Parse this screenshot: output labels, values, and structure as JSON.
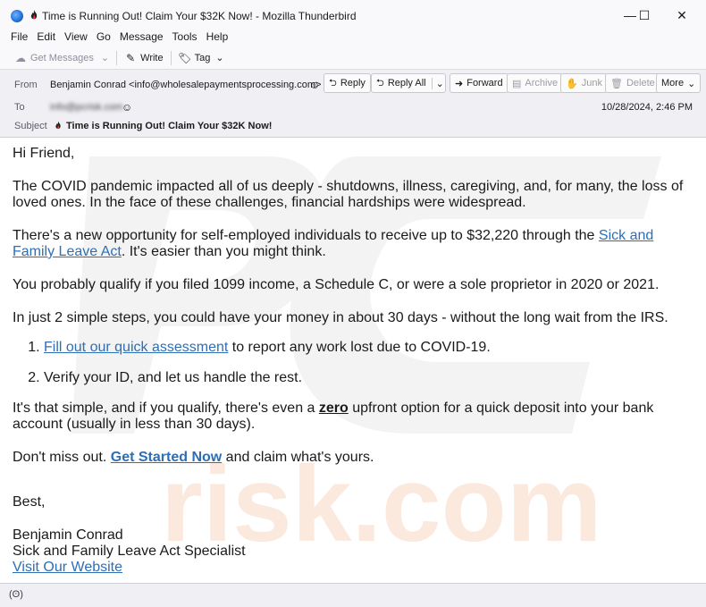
{
  "window": {
    "title": "Time is Running Out! Claim Your $32K Now! - Mozilla Thunderbird",
    "controls": {
      "minimize": "—",
      "maximize": "☐",
      "close": "✕"
    }
  },
  "menubar": {
    "items": [
      "File",
      "Edit",
      "View",
      "Go",
      "Message",
      "Tools",
      "Help"
    ]
  },
  "toolbar": {
    "get_messages": "Get Messages",
    "write": "Write",
    "tag": "Tag"
  },
  "header": {
    "from_label": "From",
    "from_value": "Benjamin Conrad <info@wholesalepaymentsprocessing.com>",
    "to_label": "To",
    "to_value": "info@pcrisk.com",
    "subject_label": "Subject",
    "subject_value": "Time is Running Out! Claim Your $32K Now!",
    "date": "10/28/2024, 2:46 PM",
    "buttons": {
      "reply": "Reply",
      "reply_all": "Reply All",
      "forward": "Forward",
      "archive": "Archive",
      "junk": "Junk",
      "delete": "Delete",
      "more": "More"
    }
  },
  "message": {
    "greeting": "Hi Friend,",
    "p1": "The COVID pandemic impacted all of us deeply - shutdowns, illness, caregiving, and, for many, the loss of loved ones. In the face of these challenges, financial hardships were widespread.",
    "p2_before": "There's a new opportunity for self-employed individuals to receive up to $32,220 through the ",
    "p2_link": "Sick and Family Leave Act",
    "p2_after": ". It's easier than you might think.",
    "p3": "You probably qualify if you filed 1099 income, a Schedule C, or were a sole proprietor in 2020 or 2021.",
    "p4": "In just 2 simple steps, you could have your money in about 30 days - without the long wait from the IRS.",
    "steps": [
      {
        "link": "Fill out our quick assessment",
        "text": " to report any work lost due to COVID-19."
      },
      {
        "link": "",
        "text": "Verify your ID, and let us handle the rest."
      }
    ],
    "p5_before": "It's that simple, and if you qualify, there's even a ",
    "p5_bold": "zero",
    "p5_after": " upfront option for a quick deposit into your bank account (usually in less than 30 days).",
    "p6_before": "Don't miss out. ",
    "p6_link": "Get Started Now",
    "p6_after": " and claim what's yours.",
    "closing": "Best,",
    "sig_name": "Benjamin Conrad",
    "sig_title": "Sick and Family Leave Act Specialist",
    "sig_link": "Visit Our Website"
  },
  "statusbar": {
    "icon": "(ʘ)"
  },
  "colors": {
    "link": "#2e6eb5",
    "header_bg": "#f0f0f4",
    "watermark": "#f4f4f4"
  }
}
